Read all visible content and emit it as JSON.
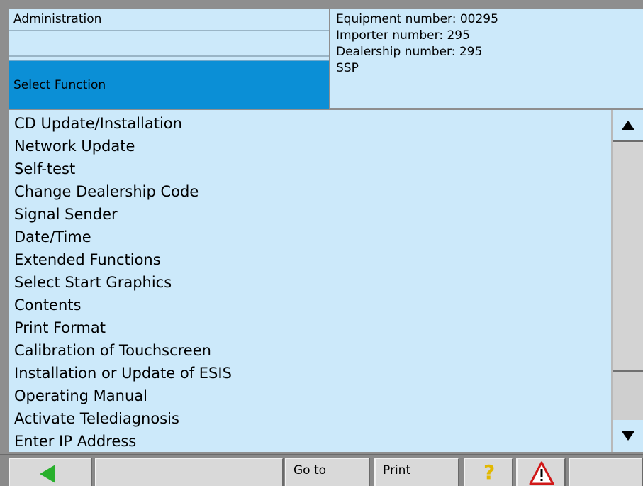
{
  "header": {
    "admin_label": "Administration",
    "select_label": "Select Function",
    "info": [
      "Equipment number: 00295",
      "Importer number: 295",
      "Dealership number: 295",
      "SSP"
    ]
  },
  "functions": [
    "CD Update/Installation",
    "Network Update",
    "Self-test",
    "Change Dealership Code",
    "Signal Sender",
    "Date/Time",
    "Extended Functions",
    "Select Start Graphics",
    "Contents",
    "Print Format",
    "Calibration of Touchscreen",
    "Installation or Update of ESIS",
    "Operating Manual",
    "Activate Telediagnosis",
    "Enter IP Address"
  ],
  "toolbar": {
    "goto_label": "Go to",
    "print_label": "Print",
    "help_icon": "question-mark-icon",
    "warn_icon": "warning-triangle-icon",
    "back_icon": "back-arrow-icon"
  },
  "colors": {
    "panel": "#cce9fa",
    "selected": "#0b8fd6",
    "back_arrow": "#28b02c",
    "help": "#e2b800",
    "warning": "#d01818"
  }
}
